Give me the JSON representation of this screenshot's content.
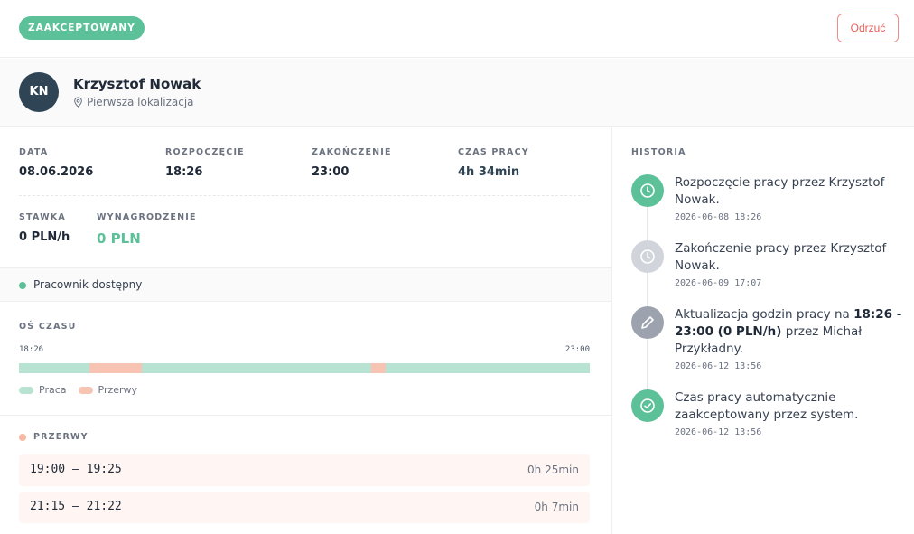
{
  "header": {
    "status": "ZAAKCEPTOWANY",
    "reject_label": "Odrzuć"
  },
  "person": {
    "initials": "KN",
    "name": "Krzysztof Nowak",
    "location": "Pierwsza lokalizacja"
  },
  "details": {
    "date_label": "DATA",
    "date_value": "08.06.2026",
    "start_label": "ROZPOCZĘCIE",
    "start_value": "18:26",
    "end_label": "ZAKOŃCZENIE",
    "end_value": "23:00",
    "worktime_label": "CZAS PRACY",
    "worktime_value": "4h 34min",
    "rate_label": "STAWKA",
    "rate_value": "0 PLN/h",
    "pay_label": "WYNAGRODZENIE",
    "pay_value": "0 PLN"
  },
  "availability": "Pracownik dostępny",
  "timeline": {
    "title": "OŚ CZASU",
    "start": "18:26",
    "end": "23:00",
    "breaks": [
      {
        "start": "19:00",
        "end": "19:25"
      },
      {
        "start": "21:15",
        "end": "21:22"
      }
    ],
    "legend_work": "Praca",
    "legend_break": "Przerwy",
    "work_color": "#b8e2d2",
    "break_color": "#f7c3b2"
  },
  "breaks": {
    "title": "PRZERWY",
    "items": [
      {
        "range": "19:00 – 19:25",
        "duration": "0h 25min"
      },
      {
        "range": "21:15 – 21:22",
        "duration": "0h 7min"
      }
    ]
  },
  "history": {
    "title": "HISTORIA",
    "items": [
      {
        "icon": "clock-icon",
        "text": "Rozpoczęcie pracy przez Krzysztof Nowak.",
        "time": "2026-06-08 18:26"
      },
      {
        "icon": "clock-icon",
        "text": "Zakończenie pracy przez Krzysztof Nowak.",
        "time": "2026-06-09 17:07"
      },
      {
        "icon": "pencil-icon",
        "text_before": "Aktualizacja godzin pracy na ",
        "text_bold": "18:26 - 23:00 (0 PLN/h)",
        "text_after": " przez Michał Przykładny.",
        "time": "2026-06-12 13:56"
      },
      {
        "icon": "check-circle-icon",
        "text": "Czas pracy automatycznie zaakceptowany przez system.",
        "time": "2026-06-12 13:56"
      }
    ]
  },
  "colors": {
    "accent_green": "#5cc199",
    "avatar_dark": "#2f4454",
    "reject_red": "#e5615a",
    "history_gray": "#d1d5db",
    "history_dark_gray": "#9ca3af"
  }
}
